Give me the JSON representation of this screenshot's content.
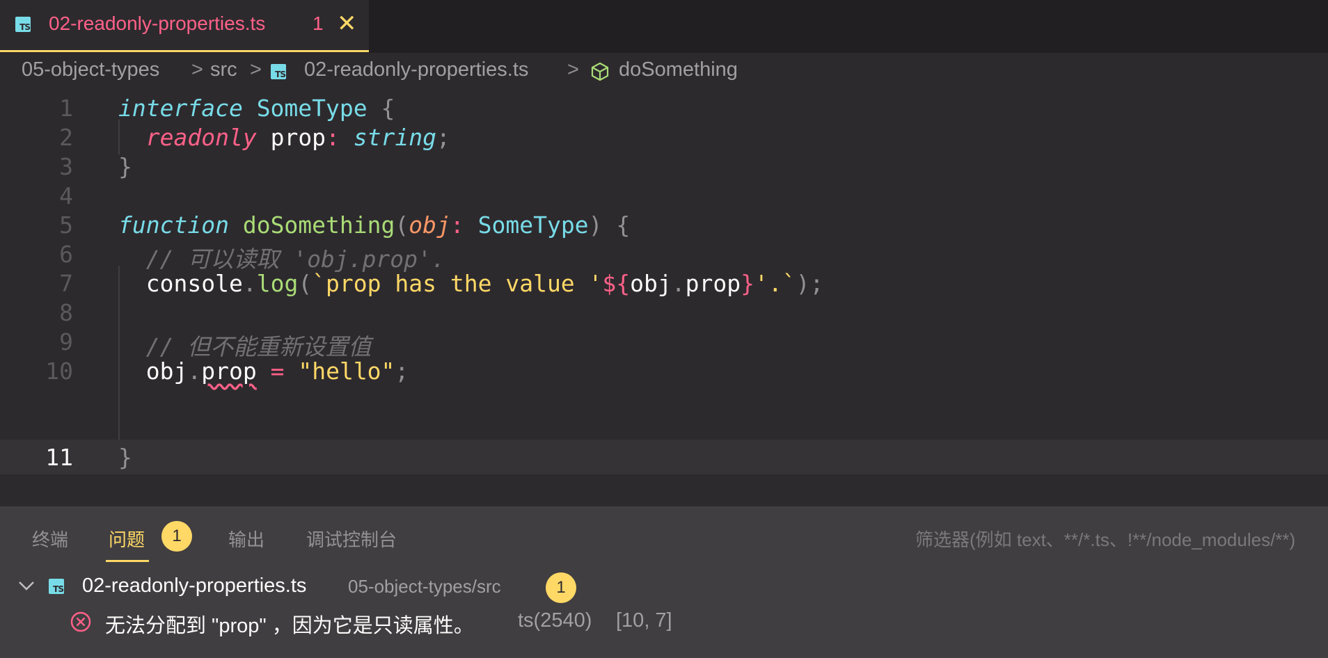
{
  "tab": {
    "filename": "02-readonly-properties.ts",
    "problem_count": "1",
    "close_glyph": "✕",
    "icon": "ts-file-icon"
  },
  "breadcrumb": {
    "items": [
      "05-object-types",
      "src",
      "02-readonly-properties.ts",
      "doSomething"
    ],
    "separator": ">"
  },
  "editor": {
    "line_numbers": [
      "1",
      "2",
      "3",
      "4",
      "5",
      "6",
      "7",
      "8",
      "9",
      "10",
      "11"
    ],
    "current_line": "11",
    "tokens": {
      "interface_kw": "interface",
      "sometype": "SomeType",
      "lbrace": "{",
      "rbrace": "}",
      "readonly_kw": "readonly",
      "prop": "prop",
      "colon": ":",
      "string_type": "string",
      "semicolon": ";",
      "function_kw": "function",
      "fn_name": "doSomething",
      "lparen": "(",
      "rparen": ")",
      "param": "obj",
      "comment1": "// 可以读取 'obj.prop'.",
      "console": "console",
      "dot": ".",
      "log": "log",
      "tmpl_open": "`prop has the value '",
      "interp_open": "${",
      "obj": "obj",
      "interp_close": "}",
      "tmpl_close": "'.`",
      "comment2": "// 但不能重新设置值",
      "eq": "=",
      "hello": "\"hello\""
    }
  },
  "panel": {
    "tabs": [
      "终端",
      "问题",
      "输出",
      "调试控制台"
    ],
    "active_tab": "问题",
    "problems_badge": "1",
    "filter_placeholder": "筛选器(例如 text、**/*.ts、!**/node_modules/**)",
    "file": {
      "name": "02-readonly-properties.ts",
      "path": "05-object-types/src",
      "count": "1"
    },
    "problem": {
      "message": "无法分配到 \"prop\" ，因为它是只读属性。",
      "code": "ts(2540)",
      "location": "[10, 7]"
    }
  },
  "colors": {
    "accent": "#ffd866",
    "error": "#ff6188",
    "type": "#78dce8",
    "function": "#a9dc76",
    "param": "#fc9867"
  }
}
